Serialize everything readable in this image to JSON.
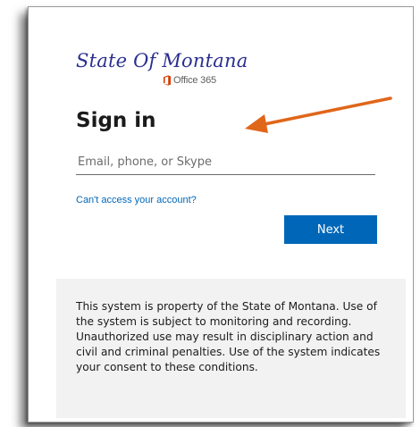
{
  "branding": {
    "org_name": "State Of Montana",
    "product_name": "Office 365",
    "product_icon": "office-icon",
    "brand_color": "#2a2f8f",
    "office_icon_color": "#d83b01"
  },
  "signin": {
    "title": "Sign in",
    "email_placeholder": "Email, phone, or Skype",
    "email_value": "",
    "help_link": "Can't access your account?",
    "next_label": "Next",
    "accent_color": "#0067b8"
  },
  "notice": {
    "text": "This system is property of the State of Montana. Use of the system is subject to monitoring and recording. Unauthorized use may result in disciplinary action and civil and criminal penalties. Use of the system indicates your consent to these conditions."
  },
  "annotation": {
    "arrow_icon": "arrow-pointing-left-icon",
    "arrow_color": "#e0661a"
  }
}
